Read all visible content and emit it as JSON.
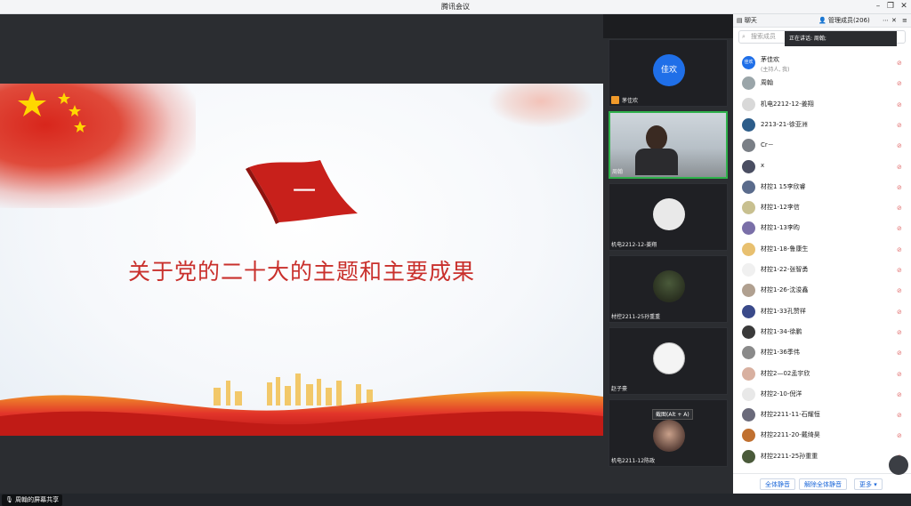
{
  "window": {
    "title": "腾讯会议"
  },
  "slide": {
    "flag_char": "一",
    "headline": "关于党的二十大的主题和主要成果",
    "theme_red": "#c9302c"
  },
  "share_status": "周翰的屏幕共享",
  "tiles": [
    {
      "name": "茅佳欢",
      "avatar_text": "佳欢",
      "type": "text-avatar",
      "accent": "#1f6fe8"
    },
    {
      "name": "周翰",
      "type": "video",
      "active": true
    },
    {
      "name": "机电2212-12-姜翔",
      "type": "default-avatar"
    },
    {
      "name": "材控2211-25孙重重",
      "type": "photo-avatar"
    },
    {
      "name": "赵子豪",
      "type": "photo-avatar"
    },
    {
      "name": "机电2211-12陈政",
      "type": "photo-avatar",
      "tooltip": "截图(Alt + A)"
    }
  ],
  "panel": {
    "tab_chat": "聊天",
    "tab_members": "管理成员(206)",
    "search_placeholder": "搜索成员",
    "speaking_label": "正在讲话: 周翰;",
    "members": [
      {
        "name": "茅佳欢",
        "sub": "(主持人, 我)",
        "avatar_text": "佳欢",
        "color": "#1f6fe8"
      },
      {
        "name": "周翰",
        "color": "#9aa5a9"
      },
      {
        "name": "机电2212-12-姜翔",
        "color": "#d8d8d8"
      },
      {
        "name": "2213-21-徐亚洲",
        "color": "#2d5d8a"
      },
      {
        "name": "Cr－",
        "color": "#7a7f86"
      },
      {
        "name": "x",
        "color": "#4a4e62"
      },
      {
        "name": "材控1 15李欣睿",
        "color": "#5a6b8c"
      },
      {
        "name": "材控1-12李信",
        "color": "#c8c090"
      },
      {
        "name": "材控1-13李昀",
        "color": "#7a6fa8"
      },
      {
        "name": "材控1-18-鲁康生",
        "color": "#e8c070"
      },
      {
        "name": "材控1-22-张智勇",
        "color": "#f0f0f0"
      },
      {
        "name": "材控1-26-沈浚鑫",
        "color": "#b0a090"
      },
      {
        "name": "材控1-33孔赞祥",
        "color": "#3a4a8a"
      },
      {
        "name": "材控1-34-徐鹏",
        "color": "#3a3a3a"
      },
      {
        "name": "材控1-36季伟",
        "color": "#8a8a8a"
      },
      {
        "name": "材控2—02孟宇欣",
        "color": "#d8b0a0"
      },
      {
        "name": "材控2-10-倪洋",
        "color": "#e8e8e8"
      },
      {
        "name": "材控2211-11-石耀恒",
        "color": "#6a6a7a"
      },
      {
        "name": "材控2211-20-戴绮昊",
        "color": "#c07030"
      },
      {
        "name": "材控2211-25孙重重",
        "color": "#4a5a3a"
      }
    ],
    "btn_mute_all": "全体静音",
    "btn_unmute_all": "解除全体静音",
    "btn_more": "更多"
  }
}
